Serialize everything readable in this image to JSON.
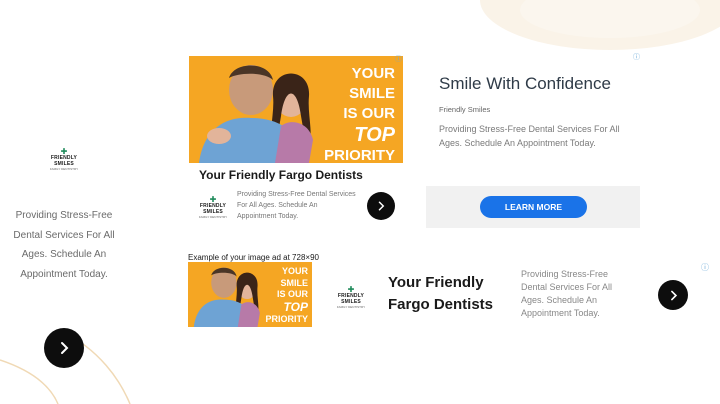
{
  "left_ad": {
    "logo_name": "FRIENDLY SMILES",
    "logo_tag": "FAMILY DENTISTRY",
    "description": "Providing Stress-Free Dental Services For All Ages. Schedule An Appointment Today.",
    "button_icon": "chevron-right-icon"
  },
  "rect_ad": {
    "slogan_line1": "YOUR",
    "slogan_line2": "SMILE",
    "slogan_line3": "IS OUR",
    "slogan_line4": "TOP",
    "slogan_line5": "PRIORITY",
    "headline": "Your Friendly Fargo Dentists",
    "logo_name": "FRIENDLY SMILES",
    "logo_tag": "FAMILY DENTISTRY",
    "description": "Providing Stress-Free Dental Services For All Ages. Schedule An Appointment Today.",
    "button_icon": "chevron-right-icon",
    "adchoice_icon": "adchoices-icon"
  },
  "text_ad": {
    "title": "Smile With Confidence",
    "advertiser": "Friendly Smiles",
    "body": "Providing Stress-Free Dental Services For All Ages. Schedule An Appointment Today.",
    "cta_label": "LEARN MORE",
    "adchoice_icon": "adchoices-icon"
  },
  "leaderboard": {
    "caption": "Example of your image ad at 728×90",
    "slogan_line1": "YOUR",
    "slogan_line2": "SMILE",
    "slogan_line3": "IS OUR",
    "slogan_line4": "TOP",
    "slogan_line5": "PRIORITY",
    "logo_name": "FRIENDLY SMILES",
    "logo_tag": "FAMILY DENTISTRY",
    "headline": "Your Friendly Fargo Dentists",
    "description": "Providing Stress-Free Dental Services For All Ages. Schedule An Appointment Today.",
    "button_icon": "chevron-right-icon",
    "adchoice_icon": "adchoices-icon"
  },
  "colors": {
    "ad_orange": "#f5a623",
    "cta_blue": "#1a73e8",
    "button_black": "#0d0d0d",
    "decor_beige": "#f4ead9"
  }
}
